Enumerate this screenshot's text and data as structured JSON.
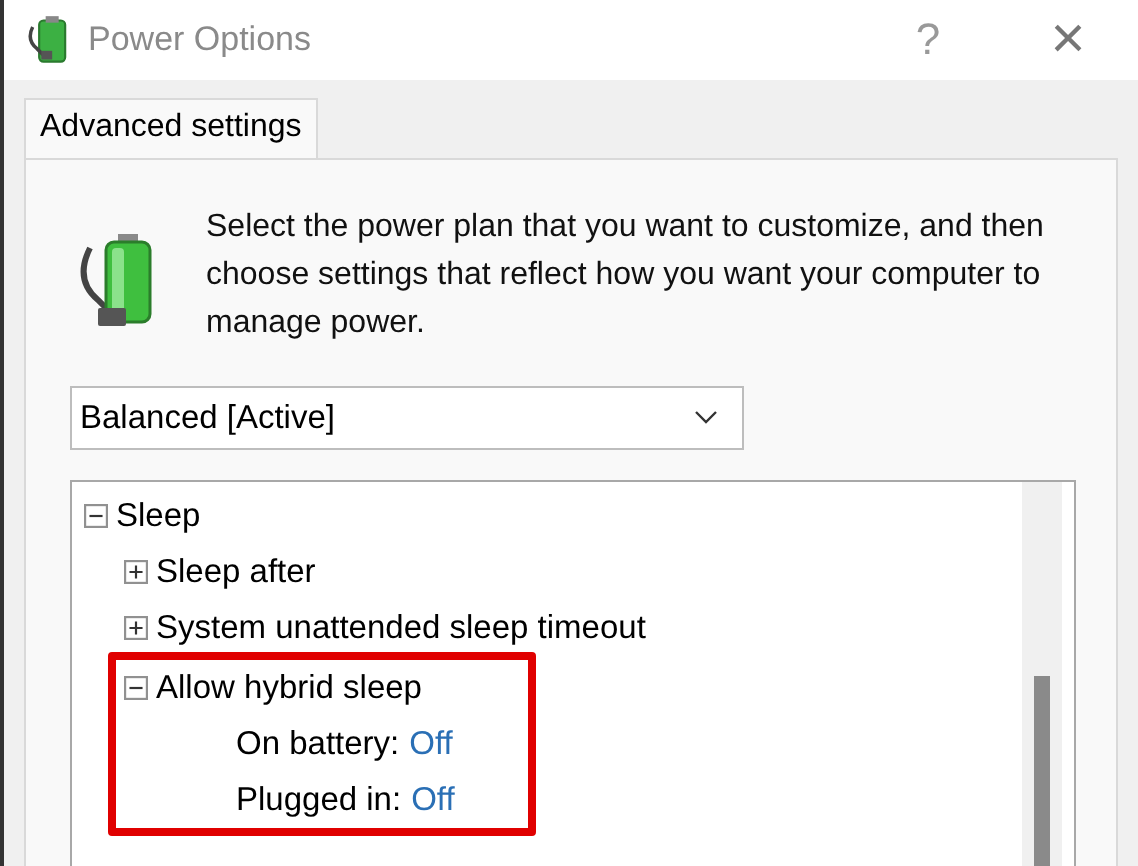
{
  "window": {
    "title": "Power Options"
  },
  "title_buttons": [
    "?",
    "×"
  ],
  "tabs": [
    {
      "label": "Advanced settings",
      "selected": true
    }
  ],
  "description": "Select the power plan that you want to customize, and then choose settings that reflect how you want your computer to manage power.",
  "plan_dropdown": {
    "value": "Balanced [Active]"
  },
  "tree": [
    {
      "label": "Sleep",
      "expanded": true,
      "highlighted": false,
      "children": [
        {
          "label": "Sleep after",
          "expanded": false,
          "highlighted": false
        },
        {
          "label": "System unattended sleep timeout",
          "expanded": false,
          "highlighted": false
        },
        {
          "label": "Allow hybrid sleep",
          "expanded": true,
          "highlighted": true,
          "children": [
            {
              "label": "On battery:",
              "value": "Off"
            },
            {
              "label": "Plugged in:",
              "value": "Off"
            }
          ]
        }
      ]
    }
  ]
}
